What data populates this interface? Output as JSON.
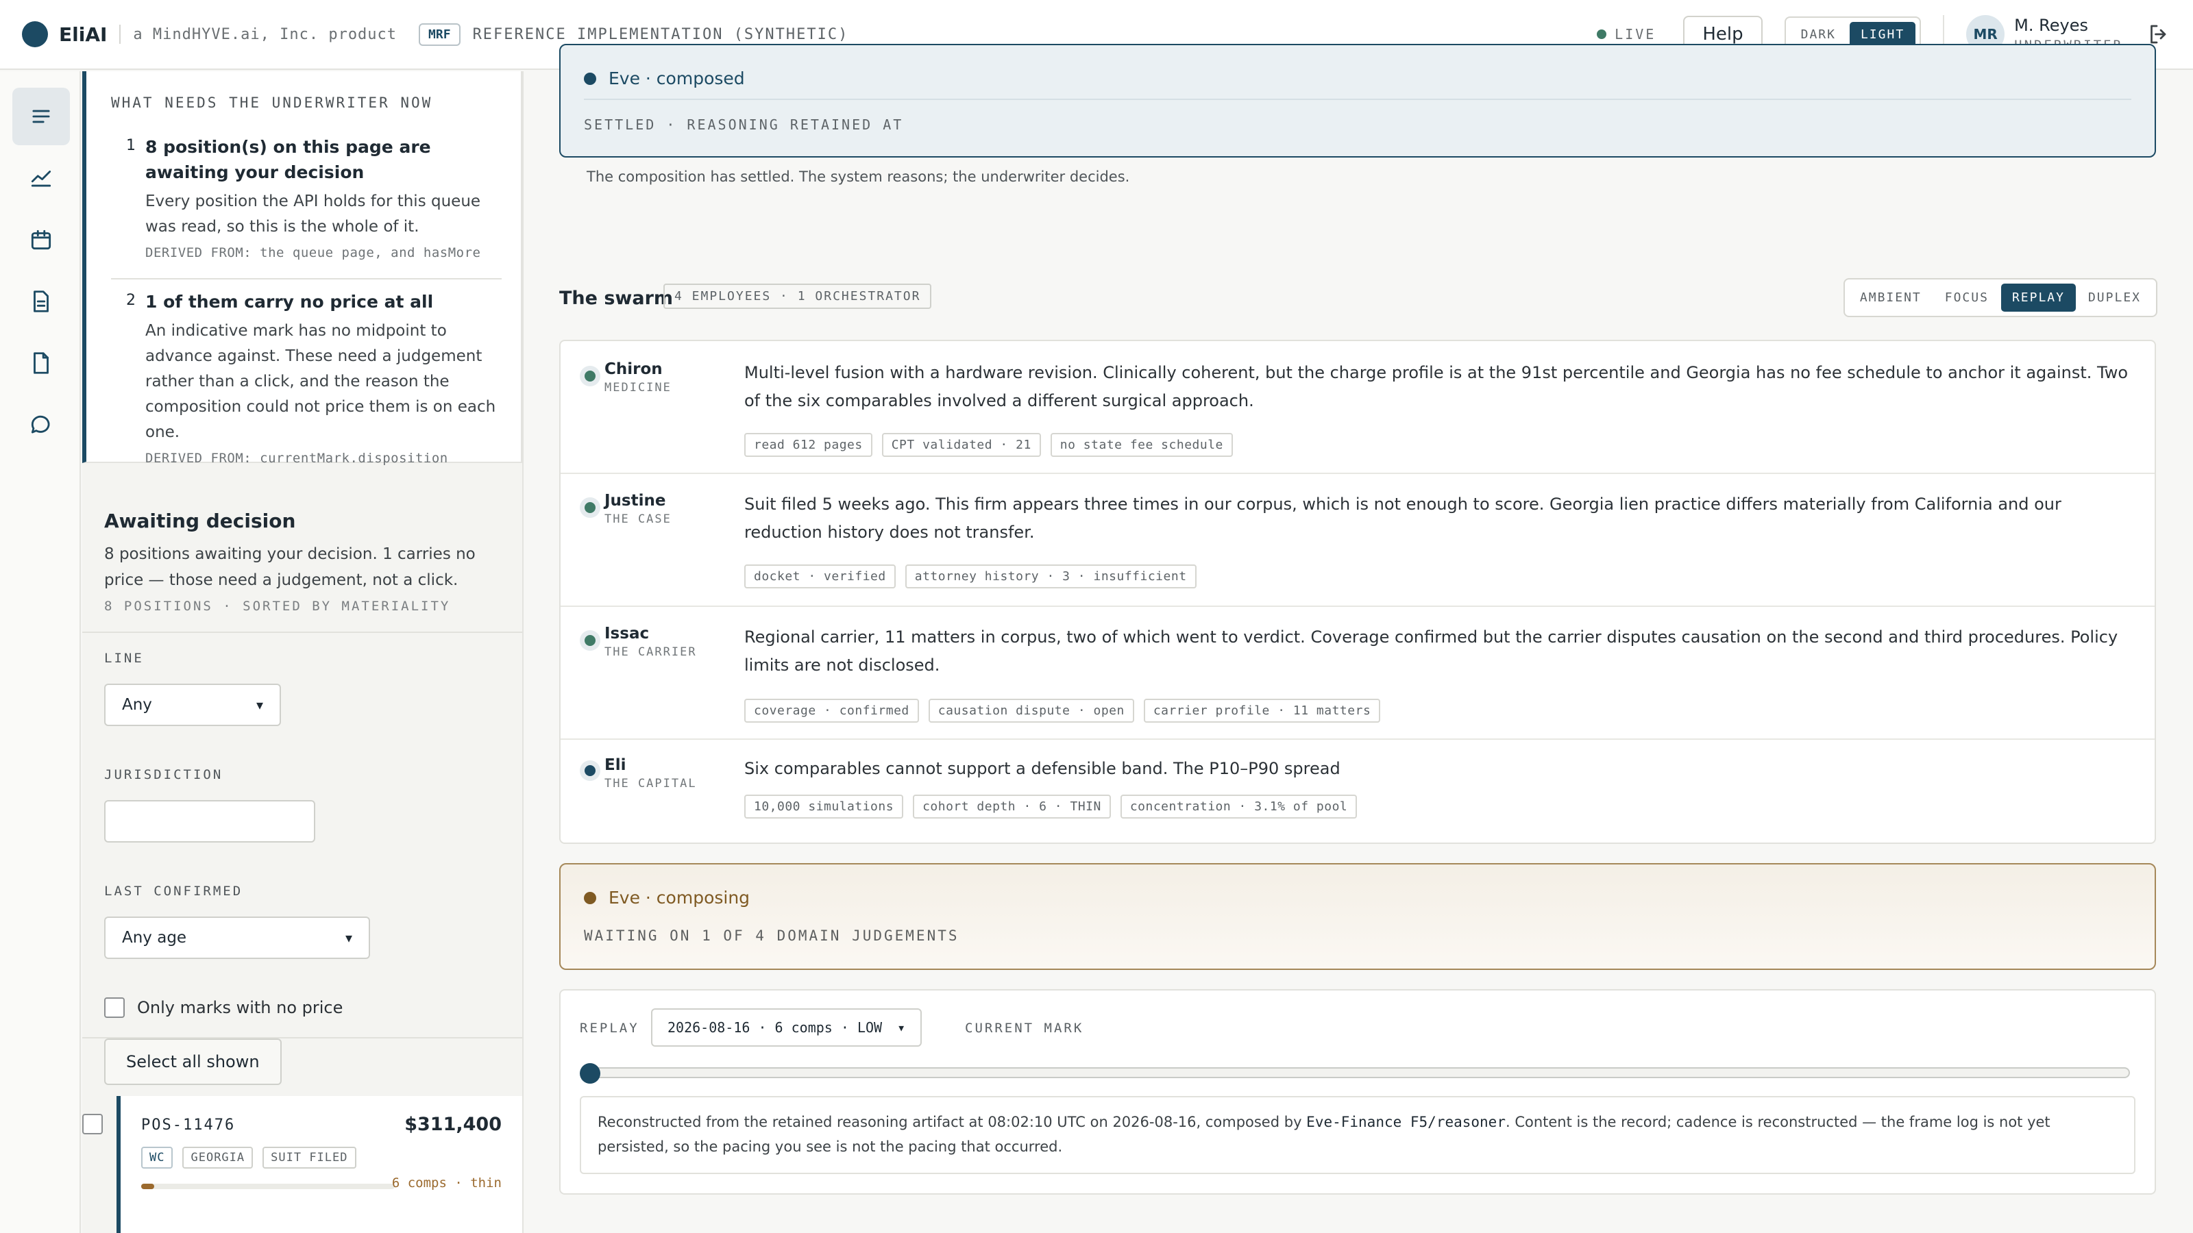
{
  "header": {
    "brand": "EliAI",
    "product_line": "a MindHYVE.ai, Inc. product",
    "mrf_badge": "MRF",
    "reference": "REFERENCE IMPLEMENTATION (SYNTHETIC)",
    "live": "LIVE",
    "help": "Help",
    "theme": {
      "dark": "DARK",
      "light": "LIGHT",
      "selected": "LIGHT"
    },
    "user": {
      "initials": "MR",
      "name": "M. Reyes",
      "role": "UNDERWRITER"
    }
  },
  "rail": {
    "items": [
      "menu-icon",
      "trend-chart-icon",
      "calendar-icon",
      "document-icon",
      "file-icon",
      "chat-icon"
    ],
    "active": "menu-icon"
  },
  "needs": {
    "title": "WHAT NEEDS THE UNDERWRITER NOW",
    "items": [
      {
        "num": "1",
        "head": "8 position(s) on this page are awaiting your decision",
        "body": "Every position the API holds for this queue was read, so this is the whole of it.",
        "derived": "DERIVED FROM: the queue page, and hasMore"
      },
      {
        "num": "2",
        "head": "1 of them carry no price at all",
        "body": "An indicative mark has no midpoint to advance against. These need a judgement rather than a click, and the reason the composition could not price them is on each one.",
        "derived": "DERIVED FROM: currentMark.disposition"
      }
    ]
  },
  "awaiting": {
    "title": "Awaiting decision",
    "desc": "8 positions awaiting your decision. 1 carries no price — those need a judgement, not a click.",
    "meta": "8 POSITIONS · SORTED BY MATERIALITY"
  },
  "filters": {
    "line_label": "LINE",
    "line_value": "Any",
    "jurisdiction_label": "JURISDICTION",
    "jurisdiction_value": "",
    "last_confirmed_label": "LAST CONFIRMED",
    "last_confirmed_value": "Any age",
    "no_price_label": "Only marks with no price",
    "select_all": "Select all shown"
  },
  "position": {
    "id": "POS-11476",
    "amount": "$311,400",
    "tags": [
      "WC",
      "GEORGIA",
      "SUIT FILED"
    ],
    "comps": "6 comps · thin",
    "depth_fraction": 0.05
  },
  "eve_settled": {
    "title": "Eve · composed",
    "note": "SETTLED · REASONING RETAINED AT",
    "caption": "The composition has settled. The system reasons; the underwriter decides."
  },
  "swarm": {
    "title": "The swarm",
    "badge": "4 EMPLOYEES · 1 ORCHESTRATOR",
    "modes": [
      "AMBIENT",
      "FOCUS",
      "REPLAY",
      "DUPLEX"
    ],
    "active_mode": "REPLAY",
    "agents": [
      {
        "name": "Chiron",
        "role": "MEDICINE",
        "text": "Multi-level fusion with a hardware revision. Clinically coherent, but the charge profile is at the 91st percentile and Georgia has no fee schedule to anchor it against. Two of the six comparables involved a different surgical approach.",
        "tags": [
          "read 612 pages",
          "CPT validated · 21",
          "no state fee schedule"
        ]
      },
      {
        "name": "Justine",
        "role": "THE CASE",
        "text": "Suit filed 5 weeks ago. This firm appears three times in our corpus, which is not enough to score. Georgia lien practice differs materially from California and our reduction history does not transfer.",
        "tags": [
          "docket · verified",
          "attorney history · 3 · insufficient"
        ]
      },
      {
        "name": "Issac",
        "role": "THE CARRIER",
        "text": "Regional carrier, 11 matters in corpus, two of which went to verdict. Coverage confirmed but the carrier disputes causation on the second and third procedures. Policy limits are not disclosed.",
        "tags": [
          "coverage · confirmed",
          "causation dispute · open",
          "carrier profile · 11 matters"
        ]
      },
      {
        "name": "Eli",
        "role": "THE CAPITAL",
        "text": "Six comparables cannot support a defensible band. The P10–P90 spread",
        "tags": [
          "10,000 simulations",
          "cohort depth · 6 · THIN",
          "concentration · 3.1% of pool"
        ]
      }
    ]
  },
  "eve_composing": {
    "title": "Eve · composing",
    "note": "WAITING ON 1 OF 4 DOMAIN JUDGEMENTS"
  },
  "replay": {
    "label": "REPLAY",
    "select_value": "2026-08-16 · 6 comps · LOW",
    "current_mark": "CURRENT MARK",
    "slider_fraction": 0,
    "note_before": "Reconstructed from the retained reasoning artifact at 08:02:10 UTC on 2026-08-16, composed by ",
    "note_code": "Eve-Finance F5/reasoner",
    "note_after": ". Content is the record; cadence is reconstructed — the frame log is not yet persisted, so the pacing you see is not the pacing that occurred."
  },
  "colors": {
    "accent": "#1c4a63",
    "live_green": "#3f7a66",
    "composing_amber": "#9b6a2e",
    "background": "#f7f7f5"
  }
}
